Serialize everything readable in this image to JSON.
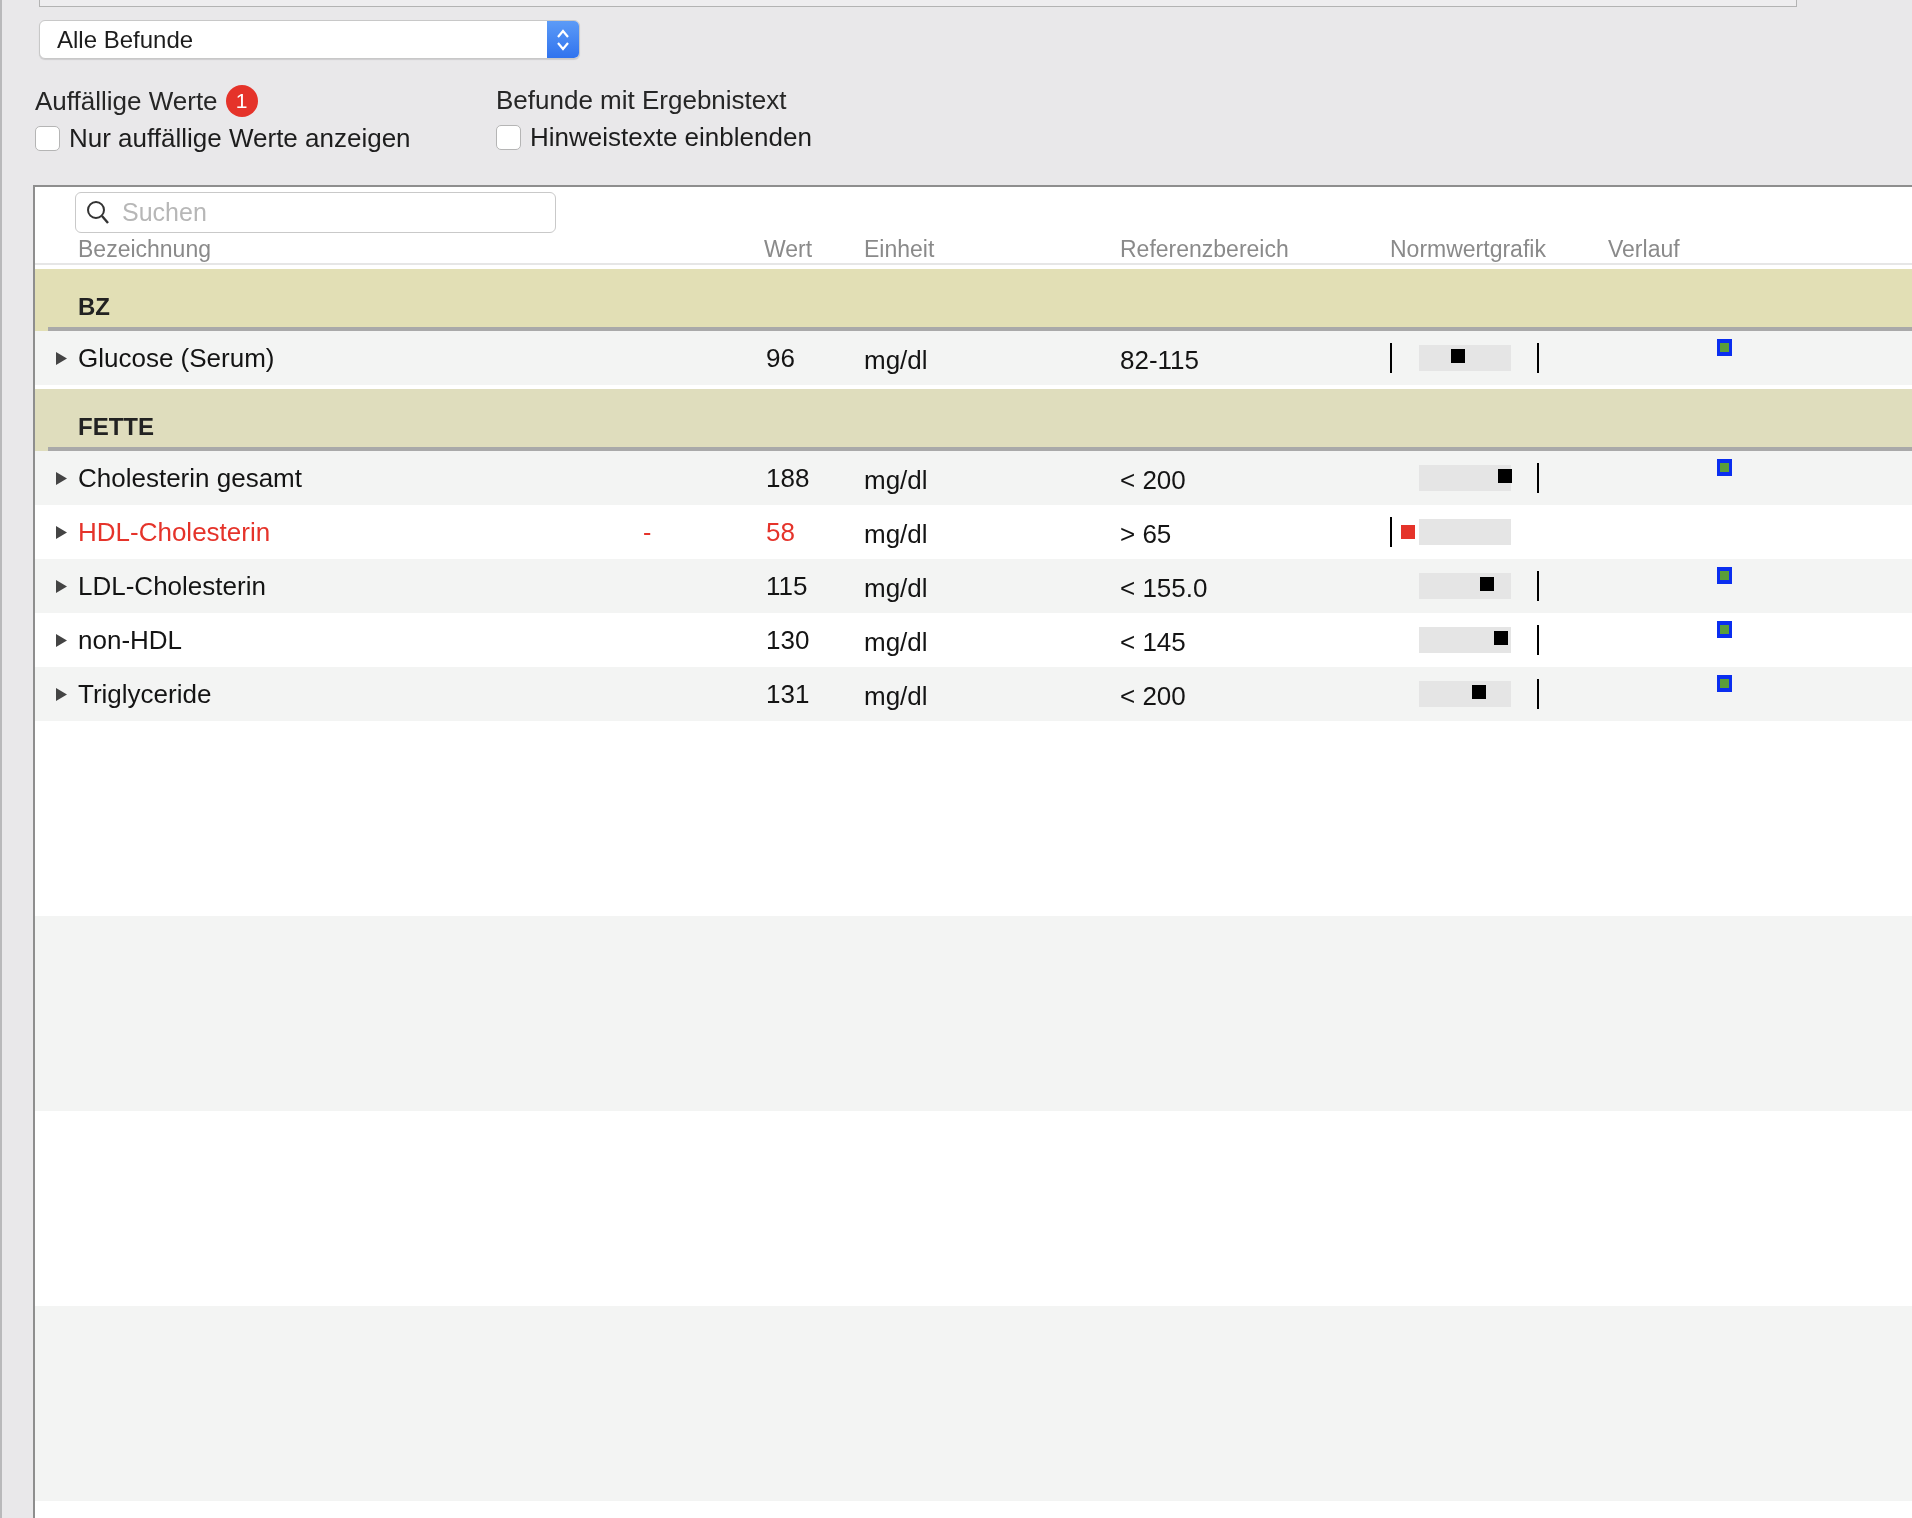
{
  "filter_select": {
    "value": "Alle Befunde"
  },
  "options": [
    {
      "heading": "Auffällige Werte",
      "badge": "1",
      "checkbox_label": "Nur auffällige Werte anzeigen",
      "checked": false
    },
    {
      "heading": "Befunde mit Ergebnistext",
      "checkbox_label": "Hinweistexte einblenden",
      "checked": false
    }
  ],
  "search": {
    "placeholder": "Suchen"
  },
  "table": {
    "columns": [
      "Bezeichnung",
      "Wert",
      "Einheit",
      "Referenzbereich",
      "Normwertgrafik",
      "Verlauf"
    ],
    "groups": [
      {
        "title": "BZ",
        "rows": [
          {
            "name": "Glucose (Serum)",
            "abnormal": false,
            "value": "96",
            "unit": "mg/dl",
            "reference": "82-115",
            "graph": {
              "kind": "normal",
              "level": 0.42,
              "low_tick": true,
              "high_tick": true
            },
            "history": true
          }
        ]
      },
      {
        "title": "FETTE",
        "rows": [
          {
            "name": "Cholesterin gesamt",
            "abnormal": false,
            "value": "188",
            "unit": "mg/dl",
            "reference": "< 200",
            "graph": {
              "kind": "normal",
              "level": 0.93,
              "low_tick": false,
              "high_tick": true
            },
            "history": true
          },
          {
            "name": "HDL-Cholesterin",
            "abnormal": true,
            "flag": "-",
            "value": "58",
            "unit": "mg/dl",
            "reference": "> 65",
            "graph": {
              "kind": "low",
              "low_tick": true,
              "high_tick": false
            },
            "history": false
          },
          {
            "name": "LDL-Cholesterin",
            "abnormal": false,
            "value": "115",
            "unit": "mg/dl",
            "reference": "< 155.0",
            "graph": {
              "kind": "normal",
              "level": 0.74,
              "low_tick": false,
              "high_tick": true
            },
            "history": true
          },
          {
            "name": "non-HDL",
            "abnormal": false,
            "value": "130",
            "unit": "mg/dl",
            "reference": "< 145",
            "graph": {
              "kind": "normal",
              "level": 0.89,
              "low_tick": false,
              "high_tick": true
            },
            "history": true
          },
          {
            "name": "Triglyceride",
            "abnormal": false,
            "value": "131",
            "unit": "mg/dl",
            "reference": "< 200",
            "graph": {
              "kind": "normal",
              "level": 0.65,
              "low_tick": false,
              "high_tick": true
            },
            "history": true
          }
        ]
      }
    ]
  }
}
